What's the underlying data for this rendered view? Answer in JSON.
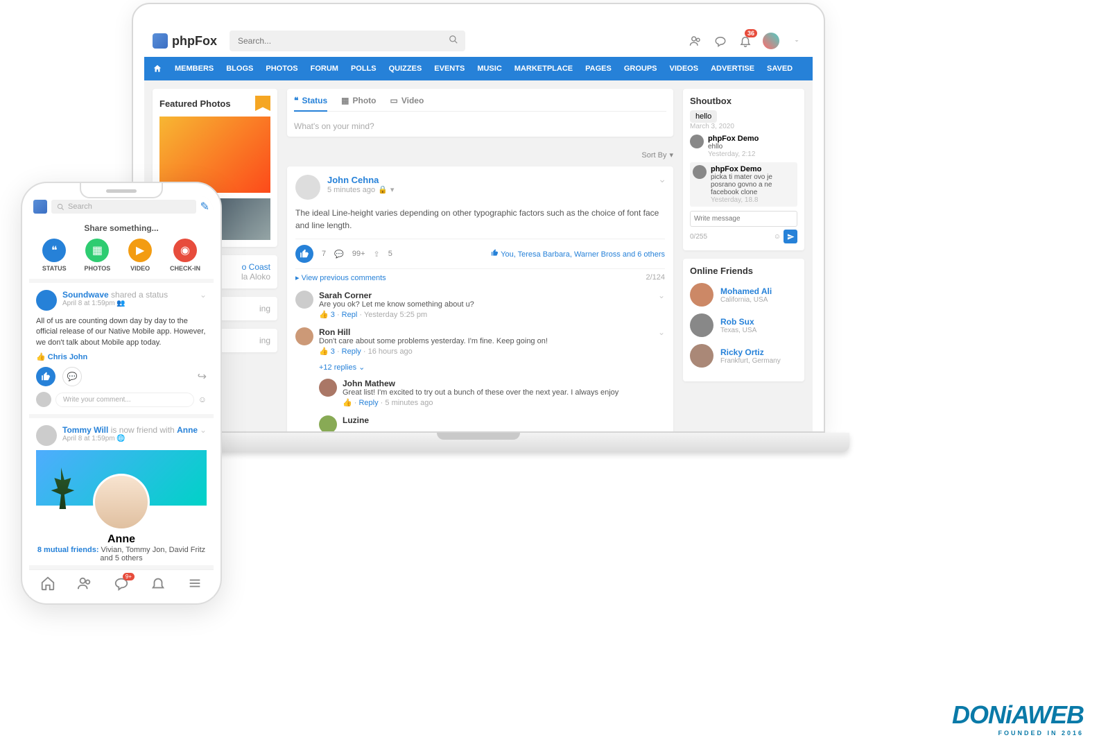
{
  "desktop": {
    "logo": "phpFox",
    "search_placeholder": "Search...",
    "notif_badge": "36",
    "nav": [
      "MEMBERS",
      "BLOGS",
      "PHOTOS",
      "FORUM",
      "POLLS",
      "QUIZZES",
      "EVENTS",
      "MUSIC",
      "MARKETPLACE",
      "PAGES",
      "GROUPS",
      "VIDEOS",
      "ADVERTISE",
      "SAVED"
    ],
    "featured_photos_title": "Featured Photos",
    "composer": {
      "tabs": {
        "status": "Status",
        "photo": "Photo",
        "video": "Video"
      },
      "placeholder": "What's on your mind?",
      "sortby": "Sort By"
    },
    "post": {
      "author": "John Cehna",
      "time": "5 minutes ago",
      "body": "The ideal Line-height varies depending on other typographic factors such as the choice of font face and line length.",
      "like_count": "7",
      "comment_count": "99+",
      "share_count": "5",
      "likes_text": "You, Teresa Barbara, Warner Bross and 6 others",
      "prev_comments": "View previous comments",
      "cmt_counter": "2/124",
      "comments": [
        {
          "user": "Sarah Corner",
          "text": "Are you ok? Let me know something about u?",
          "likes": "3",
          "reply": "Repl",
          "time": "Yesterday 5:25 pm"
        },
        {
          "user": "Ron Hill",
          "text": "Don't care about some problems yesterday. I'm fine. Keep going on!",
          "likes": "3",
          "reply": "Reply",
          "time": "16 hours ago"
        }
      ],
      "more_replies": "+12 replies",
      "nested": {
        "user": "John Mathew",
        "text": "Great list! I'm excited to try out a bunch of these over the next year. I always enjoy",
        "reply": "Reply",
        "time": "5 minutes ago"
      },
      "last_user": "Luzine"
    },
    "feed_fragments": {
      "a": "o Coast",
      "b": "la Aloko",
      "c": "ing"
    },
    "shoutbox": {
      "title": "Shoutbox",
      "msg1": "hello",
      "msg1_time": "March 3, 2020",
      "items": [
        {
          "name": "phpFox Demo",
          "msg": "ehllo",
          "time": "Yesterday, 2:12"
        },
        {
          "name": "phpFox Demo",
          "msg": "picka ti mater ovo je posrano govno a ne facebook clone",
          "time": "Yesterday, 18.8"
        }
      ],
      "input_placeholder": "Write message",
      "counter": "0/255"
    },
    "online": {
      "title": "Online Friends",
      "friends": [
        {
          "name": "Mohamed Ali",
          "loc": "California, USA"
        },
        {
          "name": "Rob Sux",
          "loc": "Texas, USA"
        },
        {
          "name": "Ricky Ortiz",
          "loc": "Frankfurt, Germany"
        }
      ]
    }
  },
  "mobile": {
    "search_placeholder": "Search",
    "share_title": "Share something...",
    "share_btns": [
      {
        "label": "STATUS",
        "color": "c-blue",
        "icon": "❝"
      },
      {
        "label": "PHOTOS",
        "color": "c-green",
        "icon": "▦"
      },
      {
        "label": "VIDEO",
        "color": "c-orange",
        "icon": "▶"
      },
      {
        "label": "CHECK-IN",
        "color": "c-red",
        "icon": "◉"
      }
    ],
    "post1": {
      "user": "Soundwave",
      "action": "shared a status",
      "time": "April 8 at 1:59pm",
      "body": "All of us are counting down day by day to the official release of our Native Mobile app. However, we don't talk about Mobile app today.",
      "likes_row": "Chris John",
      "comment_placeholder": "Write your comment..."
    },
    "post2": {
      "user": "Tommy Will",
      "action": "is now friend with",
      "target": "Anne",
      "time": "April 8 at 1:59pm",
      "name": "Anne",
      "mutual_label": "8 mutual friends:",
      "mutual_list": "Vivian, Tommy Jon, David Fritz and 5 others"
    },
    "tab_badge": "9+"
  },
  "watermark": {
    "main": "DONiAWEB",
    "sub": "FOUNDED IN 2016"
  }
}
